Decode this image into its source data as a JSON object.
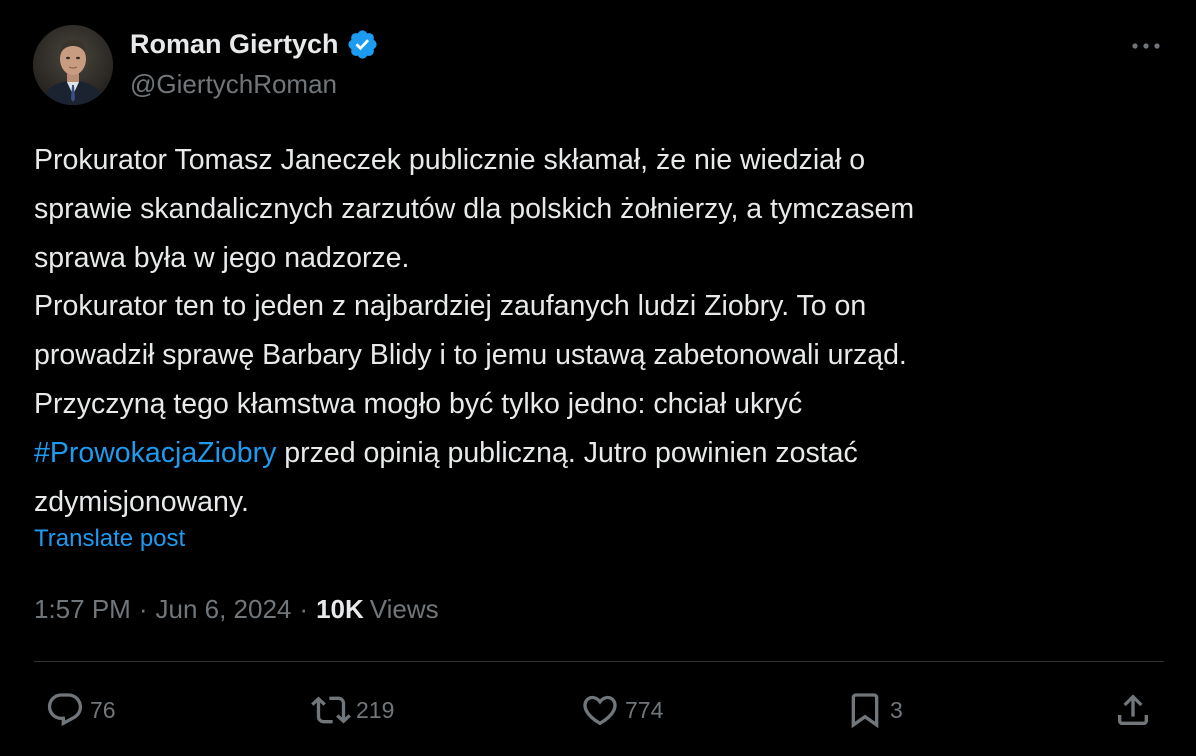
{
  "author": {
    "name": "Roman Giertych",
    "handle": "@GiertychRoman",
    "verified_icon": "verified-badge-icon",
    "verified_color": "#1d9bf0"
  },
  "post": {
    "lines": [
      "Prokurator Tomasz Janeczek publicznie skłamał, że nie wiedział o",
      "sprawie skandalicznych zarzutów dla polskich żołnierzy, a tymczasem",
      "sprawa była w jego nadzorze.",
      "Prokurator ten to jeden z najbardziej zaufanych ludzi Ziobry. To on",
      "prowadził sprawę Barbary Blidy i to jemu ustawą zabetonowali urząd.",
      "Przyczyną tego kłamstwa mogło być tylko jedno: chciał ukryć"
    ],
    "hashtag": "#ProwokacjaZiobry",
    "after_hashtag": " przed opinią publiczną. Jutro powinien zostać",
    "last_line": "zdymisjonowany.",
    "translate_label": "Translate post"
  },
  "meta": {
    "time": "1:57 PM",
    "separator": "·",
    "date": "Jun 6, 2024",
    "views_count": "10K",
    "views_label": "Views"
  },
  "actions": {
    "reply_count": "76",
    "repost_count": "219",
    "like_count": "774",
    "bookmark_count": "3"
  },
  "colors": {
    "background": "#000000",
    "text": "#e7e9ea",
    "secondary": "#71767b",
    "accent": "#1d9bf0",
    "divider": "#2f3336"
  }
}
